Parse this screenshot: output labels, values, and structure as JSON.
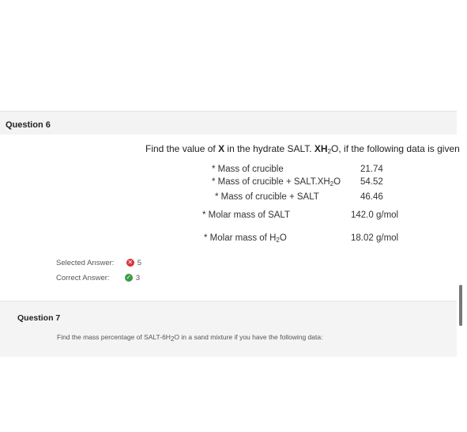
{
  "question6": {
    "title": "Question 6",
    "prompt_pre": "Find the value of ",
    "prompt_x": "X",
    "prompt_mid": " in the hydrate SALT. ",
    "prompt_xh": "XH",
    "prompt_sub": "2",
    "prompt_post": "O, if the following data is given",
    "rows": [
      {
        "label_pre": "* Mass of crucible",
        "label_sub": "",
        "label_post": "",
        "value": "21.74"
      },
      {
        "label_pre": "* Mass of crucible + SALT.XH",
        "label_sub": "2",
        "label_post": "O",
        "value": "54.52"
      },
      {
        "label_pre": "* Mass of crucible + SALT",
        "label_sub": "",
        "label_post": "",
        "value": "46.46"
      },
      {
        "label_pre": "* Molar mass of SALT",
        "label_sub": "",
        "label_post": "",
        "value": "142.0 g/mol"
      },
      {
        "label_pre": "* Molar mass of H",
        "label_sub": "2",
        "label_post": "O",
        "value": "18.02 g/mol"
      }
    ],
    "selected_label": "Selected Answer:",
    "selected_value": "5",
    "selected_status": "incorrect",
    "correct_label": "Correct Answer:",
    "correct_value": "3",
    "correct_status": "correct"
  },
  "question7": {
    "title": "Question 7",
    "text_pre": "Find the mass percentage of SALT-6H",
    "text_sub": "2",
    "text_post": "O in a sand mixture if you have the following data:"
  },
  "icons": {
    "incorrect": "x-circle-icon",
    "correct": "check-circle-icon"
  },
  "colors": {
    "incorrect": "#d9343a",
    "correct": "#3a9a46"
  }
}
